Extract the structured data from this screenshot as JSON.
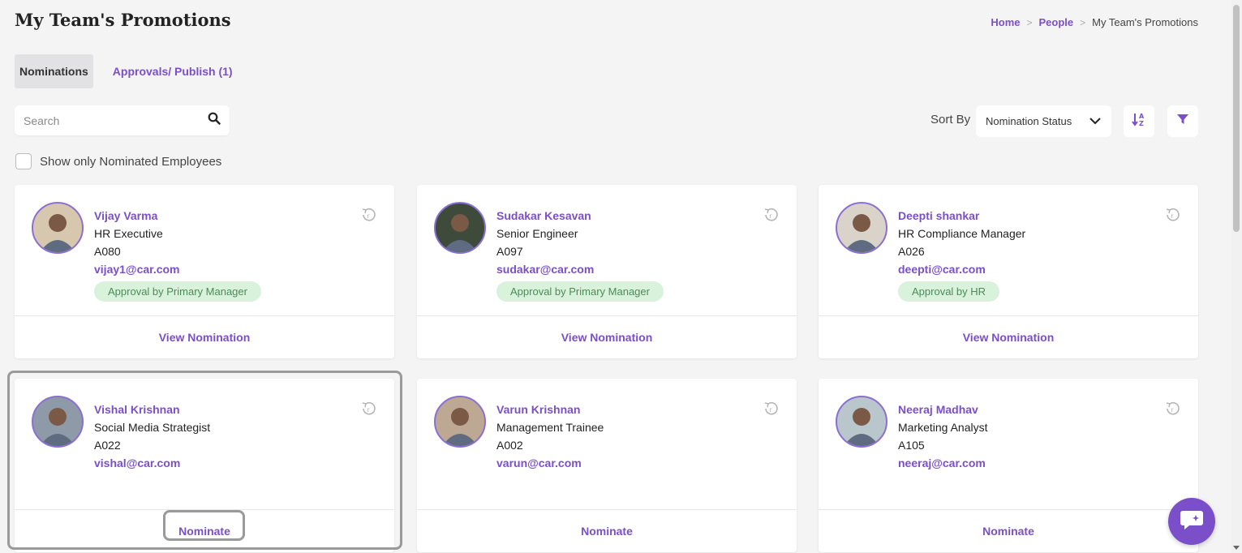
{
  "page": {
    "title": "My Team's Promotions"
  },
  "breadcrumb": {
    "home": "Home",
    "people": "People",
    "current": "My Team's Promotions",
    "separator": ">"
  },
  "tabs": [
    {
      "label": "Nominations",
      "active": true
    },
    {
      "label": "Approvals/ Publish (1)",
      "active": false
    }
  ],
  "search": {
    "placeholder": "Search",
    "icon": "search-icon"
  },
  "sort": {
    "label": "Sort By",
    "selected": "Nomination Status"
  },
  "filter_checkbox": {
    "label": "Show only Nominated Employees",
    "checked": false
  },
  "employees": [
    {
      "name": "Vijay Varma",
      "role": "HR Executive",
      "code": "A080",
      "email": "vijay1@car.com",
      "status": "Approval by Primary Manager",
      "action": "View Nomination"
    },
    {
      "name": "Sudakar Kesavan",
      "role": "Senior Engineer",
      "code": "A097",
      "email": "sudakar@car.com",
      "status": "Approval by Primary Manager",
      "action": "View Nomination"
    },
    {
      "name": "Deepti shankar",
      "role": "HR Compliance Manager",
      "code": "A026",
      "email": "deepti@car.com",
      "status": "Approval by HR",
      "action": "View Nomination"
    },
    {
      "name": "Vishal Krishnan",
      "role": "Social Media Strategist",
      "code": "A022",
      "email": "vishal@car.com",
      "status": "",
      "action": "Nominate"
    },
    {
      "name": "Varun Krishnan",
      "role": "Management Trainee",
      "code": "A002",
      "email": "varun@car.com",
      "status": "",
      "action": "Nominate"
    },
    {
      "name": "Neeraj Madhav",
      "role": "Marketing Analyst",
      "code": "A105",
      "email": "neeraj@car.com",
      "status": "",
      "action": "Nominate"
    }
  ],
  "colors": {
    "accent": "#7b4fc9",
    "badge_bg": "#d9f2dc",
    "badge_text": "#4c8b58",
    "page_bg": "#f4f4f5"
  }
}
